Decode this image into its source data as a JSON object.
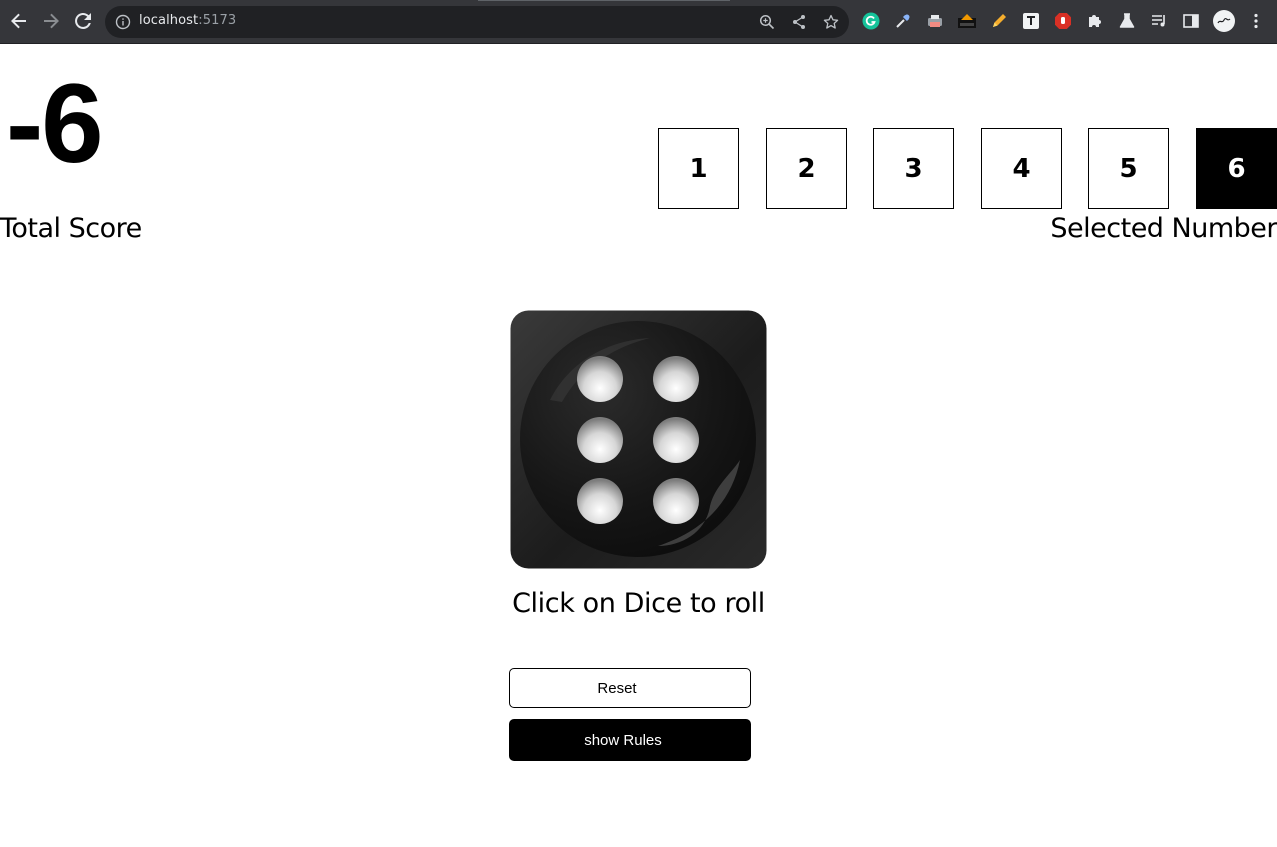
{
  "browser": {
    "url_host": "localhost",
    "url_port": ":5173",
    "colors": {
      "toolbar": "#35363a",
      "omnibox": "#202124",
      "text": "#e8eaed"
    },
    "toolbar_icons": [
      "back-icon",
      "forward-icon",
      "reload-icon",
      "site-info-icon",
      "zoom-icon",
      "share-icon",
      "bookmark-star-icon"
    ],
    "extension_icons": [
      "grammarly-icon",
      "eyedropper-icon",
      "extension-printer-icon",
      "extension-dark-icon",
      "pencil-icon",
      "text-t-icon",
      "stop-hand-icon",
      "puzzle-icon",
      "flask-icon",
      "media-queue-icon",
      "side-panel-icon",
      "profile-avatar-icon",
      "menu-dots-icon"
    ]
  },
  "game": {
    "total_score": "-6",
    "total_score_label": "Total Score",
    "selected_number_label": "Selected Number",
    "numbers": [
      "1",
      "2",
      "3",
      "4",
      "5",
      "6"
    ],
    "selected_number": "6",
    "dice_face": 6,
    "roll_instruction": "Click on Dice to roll",
    "reset_label": "Reset",
    "rules_label": "show Rules"
  }
}
